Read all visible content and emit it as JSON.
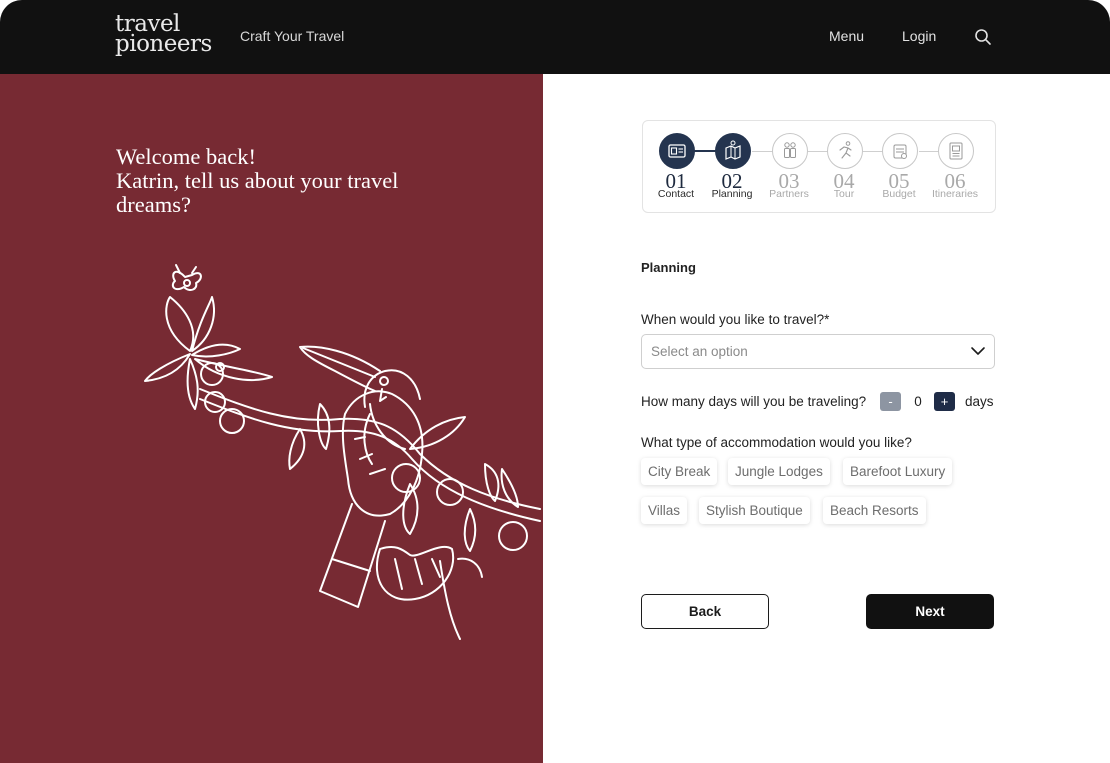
{
  "brand": {
    "logo_line1": "travel",
    "logo_line2": "pioneers",
    "tagline": "Craft Your Travel"
  },
  "nav": {
    "menu_label": "Menu",
    "login_label": "Login",
    "search_icon": "search-icon"
  },
  "hero": {
    "line1": "Welcome back!",
    "line2": "Katrin, tell us about your travel",
    "line3": "dreams?",
    "illustration": "toucan-on-branch-line-art",
    "panel_color": "#772a33"
  },
  "stepper": {
    "steps": [
      {
        "num": "01",
        "label": "Contact",
        "icon": "id-card-icon",
        "state": "done"
      },
      {
        "num": "02",
        "label": "Planning",
        "icon": "map-icon",
        "state": "current"
      },
      {
        "num": "03",
        "label": "Partners",
        "icon": "people-icon",
        "state": "todo"
      },
      {
        "num": "04",
        "label": "Tour",
        "icon": "runner-icon",
        "state": "todo"
      },
      {
        "num": "05",
        "label": "Budget",
        "icon": "wallet-icon",
        "state": "todo"
      },
      {
        "num": "06",
        "label": "Itineraries",
        "icon": "document-icon",
        "state": "todo"
      }
    ],
    "active_color": "#24344f"
  },
  "form": {
    "section_title": "Planning",
    "travel_when": {
      "label": "When would you like to travel?*",
      "placeholder": "Select an option"
    },
    "days": {
      "label": "How many days will you be traveling?",
      "minus": "-",
      "value": "0",
      "plus": "+",
      "unit": "days"
    },
    "accommodation": {
      "label": "What type of accommodation would you like?",
      "options": [
        "City Break",
        "Jungle Lodges",
        "Barefoot Luxury",
        "Villas",
        "Stylish Boutique",
        "Beach Resorts"
      ]
    },
    "back_label": "Back",
    "next_label": "Next"
  }
}
